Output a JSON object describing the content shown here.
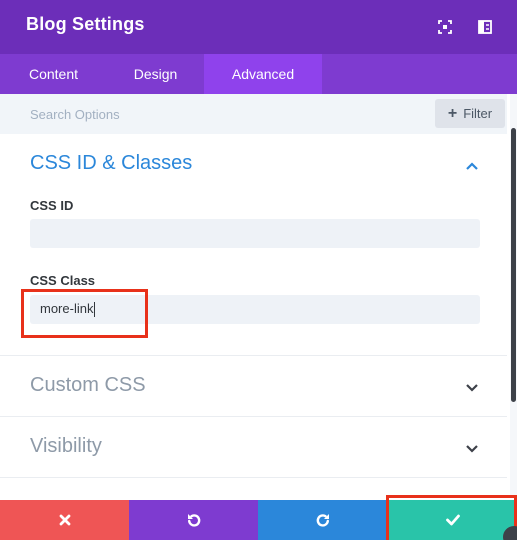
{
  "header": {
    "title": "Blog Settings",
    "icons": [
      "expand-icon",
      "sidebar-layout-icon"
    ]
  },
  "tabs": [
    {
      "label": "Content",
      "active": false
    },
    {
      "label": "Design",
      "active": false
    },
    {
      "label": "Advanced",
      "active": true
    }
  ],
  "search": {
    "placeholder": "Search Options",
    "filter_label": "Filter"
  },
  "sections": {
    "css": {
      "title": "CSS ID & Classes",
      "expanded": true,
      "fields": {
        "css_id": {
          "label": "CSS ID",
          "value": ""
        },
        "css_class": {
          "label": "CSS Class",
          "value": "more-link"
        }
      }
    },
    "custom_css": {
      "title": "Custom CSS",
      "expanded": false
    },
    "visibility": {
      "title": "Visibility",
      "expanded": false
    }
  },
  "footer": {
    "buttons": [
      "cancel-icon",
      "undo-icon",
      "redo-icon",
      "save-check-icon"
    ]
  },
  "colors": {
    "header_bg": "#6c2eb9",
    "tabs_bg": "#7e3bd0",
    "active_tab_bg": "#8f42ec",
    "accent_blue": "#2b87da",
    "cancel": "#ef5555",
    "undo": "#7e3bd0",
    "redo": "#2b87da",
    "save": "#29c4a9",
    "highlight": "#e8311a"
  }
}
